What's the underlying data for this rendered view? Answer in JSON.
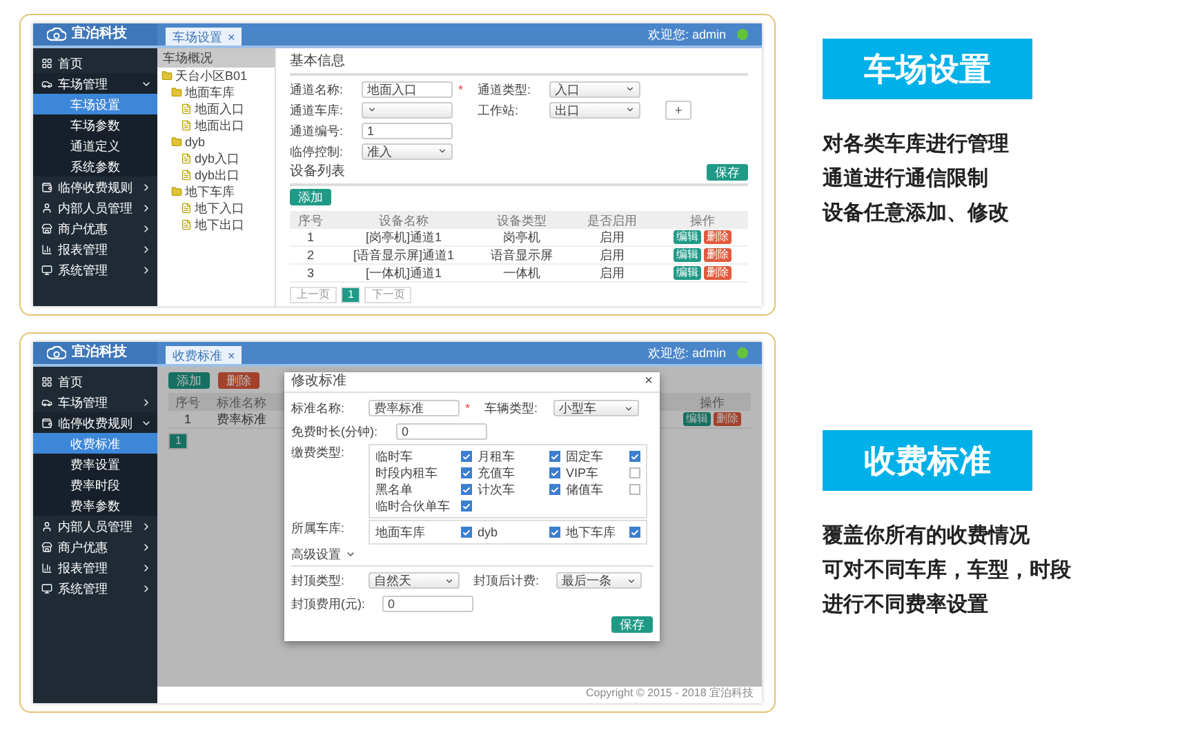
{
  "garage_screen": {
    "logo": "宜泊科技",
    "tabs": [
      {
        "label": "车场设置",
        "close": "×",
        "selected": true
      }
    ],
    "user": "欢迎您: admin",
    "sidebar": [
      {
        "label": "首页"
      },
      {
        "label": "车场管理",
        "expanded": true,
        "children": [
          {
            "label": "车场设置",
            "selected": true
          },
          {
            "label": "车场参数",
            "selected": false
          },
          {
            "label": "通道定义",
            "selected": false
          },
          {
            "label": "系统参数",
            "selected": false
          }
        ]
      },
      {
        "label": "临停收费规则",
        "expanded": false
      },
      {
        "label": "内部人员管理",
        "expanded": false
      },
      {
        "label": "商户优惠",
        "expanded": false
      },
      {
        "label": "报表管理",
        "expanded": false
      },
      {
        "label": "系统管理",
        "expanded": false
      }
    ],
    "tree": {
      "title": "车场概况",
      "nodes": [
        {
          "label": "天台小区B01",
          "children": [
            {
              "label": "地面车库",
              "children": [
                {
                  "label": "地面入口"
                },
                {
                  "label": "地面出口"
                }
              ]
            },
            {
              "label": "dyb",
              "children": [
                {
                  "label": "dyb入口"
                },
                {
                  "label": "dyb出口"
                }
              ]
            },
            {
              "label": "地下车库",
              "children": [
                {
                  "label": "地下入口"
                },
                {
                  "label": "地下出口"
                }
              ]
            }
          ]
        }
      ]
    },
    "basic_title": "基本信息",
    "form_rows": [
      [
        {
          "label": "通道名称:",
          "kind": "text",
          "value": "地面入口",
          "mark": "*"
        },
        {
          "label": "通道类型:",
          "kind": "select",
          "value": "入口"
        }
      ],
      [
        {
          "label": "通道车库:",
          "kind": "select"
        },
        {
          "label": "工作站:",
          "kind": "select",
          "value": "出口",
          "extra": "+"
        }
      ],
      [
        {
          "label": "通道编号:",
          "kind": "text",
          "value": "1"
        }
      ],
      [
        {
          "label": "临停控制:",
          "kind": "select",
          "value": "准入"
        }
      ]
    ],
    "save": "保存",
    "device_title": "设备列表",
    "add": "添加",
    "columns": [
      "序号",
      "设备名称",
      "设备类型",
      "是否启用",
      "操作"
    ],
    "rows": [
      {
        "cells": [
          "1",
          "[岗亭机]通道1",
          "岗亭机",
          "启用"
        ],
        "actions": [
          "编辑",
          "删除"
        ]
      },
      {
        "cells": [
          "2",
          "[语音显示屏]通道1",
          "语音显示屏",
          "启用"
        ],
        "actions": [
          "编辑",
          "删除"
        ]
      },
      {
        "cells": [
          "3",
          "[一体机]通道1",
          "一体机",
          "启用"
        ],
        "actions": [
          "编辑",
          "删除"
        ]
      }
    ],
    "pager": [
      {
        "label": "上一页",
        "selected": false
      },
      {
        "label": "1",
        "selected": true
      },
      {
        "label": "下一页",
        "selected": false
      }
    ]
  },
  "fee_screen": {
    "logo": "宜泊科技",
    "tabs": [
      {
        "label": "收费标准",
        "close": "×",
        "selected": true
      }
    ],
    "user": "欢迎您: admin",
    "sidebar": [
      {
        "label": "首页"
      },
      {
        "label": "车场管理",
        "expanded": false
      },
      {
        "label": "临停收费规则",
        "expanded": true,
        "children": [
          {
            "label": "收费标准",
            "selected": true
          },
          {
            "label": "费率设置",
            "selected": false
          },
          {
            "label": "费率时段",
            "selected": false
          },
          {
            "label": "费率参数",
            "selected": false
          }
        ]
      },
      {
        "label": "内部人员管理",
        "expanded": false
      },
      {
        "label": "商户优惠",
        "expanded": false
      },
      {
        "label": "报表管理",
        "expanded": false
      },
      {
        "label": "系统管理",
        "expanded": false
      }
    ],
    "buttons": [
      {
        "label": "添加",
        "kind": "add"
      },
      {
        "label": "删除",
        "kind": "delete"
      }
    ],
    "columns": [
      "序号",
      "标准名称",
      "操作"
    ],
    "rows": [
      {
        "cells": [
          "1",
          "费率标准"
        ],
        "actions": [
          "编辑",
          "删除"
        ]
      }
    ],
    "pager": [
      {
        "label": "1",
        "selected": true
      }
    ],
    "footer": "Copyright © 2015 - 2018 宜泊科技",
    "modal": {
      "title": "修改标准",
      "close": "×",
      "name": {
        "label": "标准名称:",
        "value": "费率标准",
        "mark": "*"
      },
      "car_type": {
        "label": "车辆类型:",
        "value": "小型车"
      },
      "free_time": {
        "label": "免费时长(分钟):",
        "value": "0"
      },
      "fee_types": {
        "label": "缴费类型:",
        "options": [
          {
            "label": "临时车",
            "checked": true
          },
          {
            "label": "月租车",
            "checked": true
          },
          {
            "label": "固定车",
            "checked": true
          },
          {
            "label": "时段内租车",
            "checked": true
          },
          {
            "label": "充值车",
            "checked": true
          },
          {
            "label": "VIP车",
            "checked": false
          },
          {
            "label": "黑名单",
            "checked": true
          },
          {
            "label": "计次车",
            "checked": true
          },
          {
            "label": "储值车",
            "checked": false
          },
          {
            "label": "临时合伙单车",
            "checked": true
          }
        ]
      },
      "garages": {
        "label": "所属车库:",
        "options": [
          {
            "label": "地面车库",
            "checked": true
          },
          {
            "label": "dyb",
            "checked": true
          },
          {
            "label": "地下车库",
            "checked": true
          }
        ]
      },
      "advanced": {
        "label": "高级设置",
        "expanded": true
      },
      "cap_type": {
        "label": "封顶类型:",
        "value": "自然天"
      },
      "after_cap": {
        "label": "封顶后计费:",
        "value": "最后一条"
      },
      "cap_fee": {
        "label": "封顶费用(元):",
        "value": "0"
      },
      "save": "保存"
    }
  },
  "features": [
    {
      "title": "车场设置",
      "lines": [
        "对各类车库进行管理",
        "通道进行通信限制",
        "设备任意添加、修改"
      ]
    },
    {
      "title": "收费标准",
      "lines": [
        "覆盖你所有的收费情况",
        "可对不同车库，车型，时段",
        "进行不同费率设置"
      ]
    }
  ]
}
